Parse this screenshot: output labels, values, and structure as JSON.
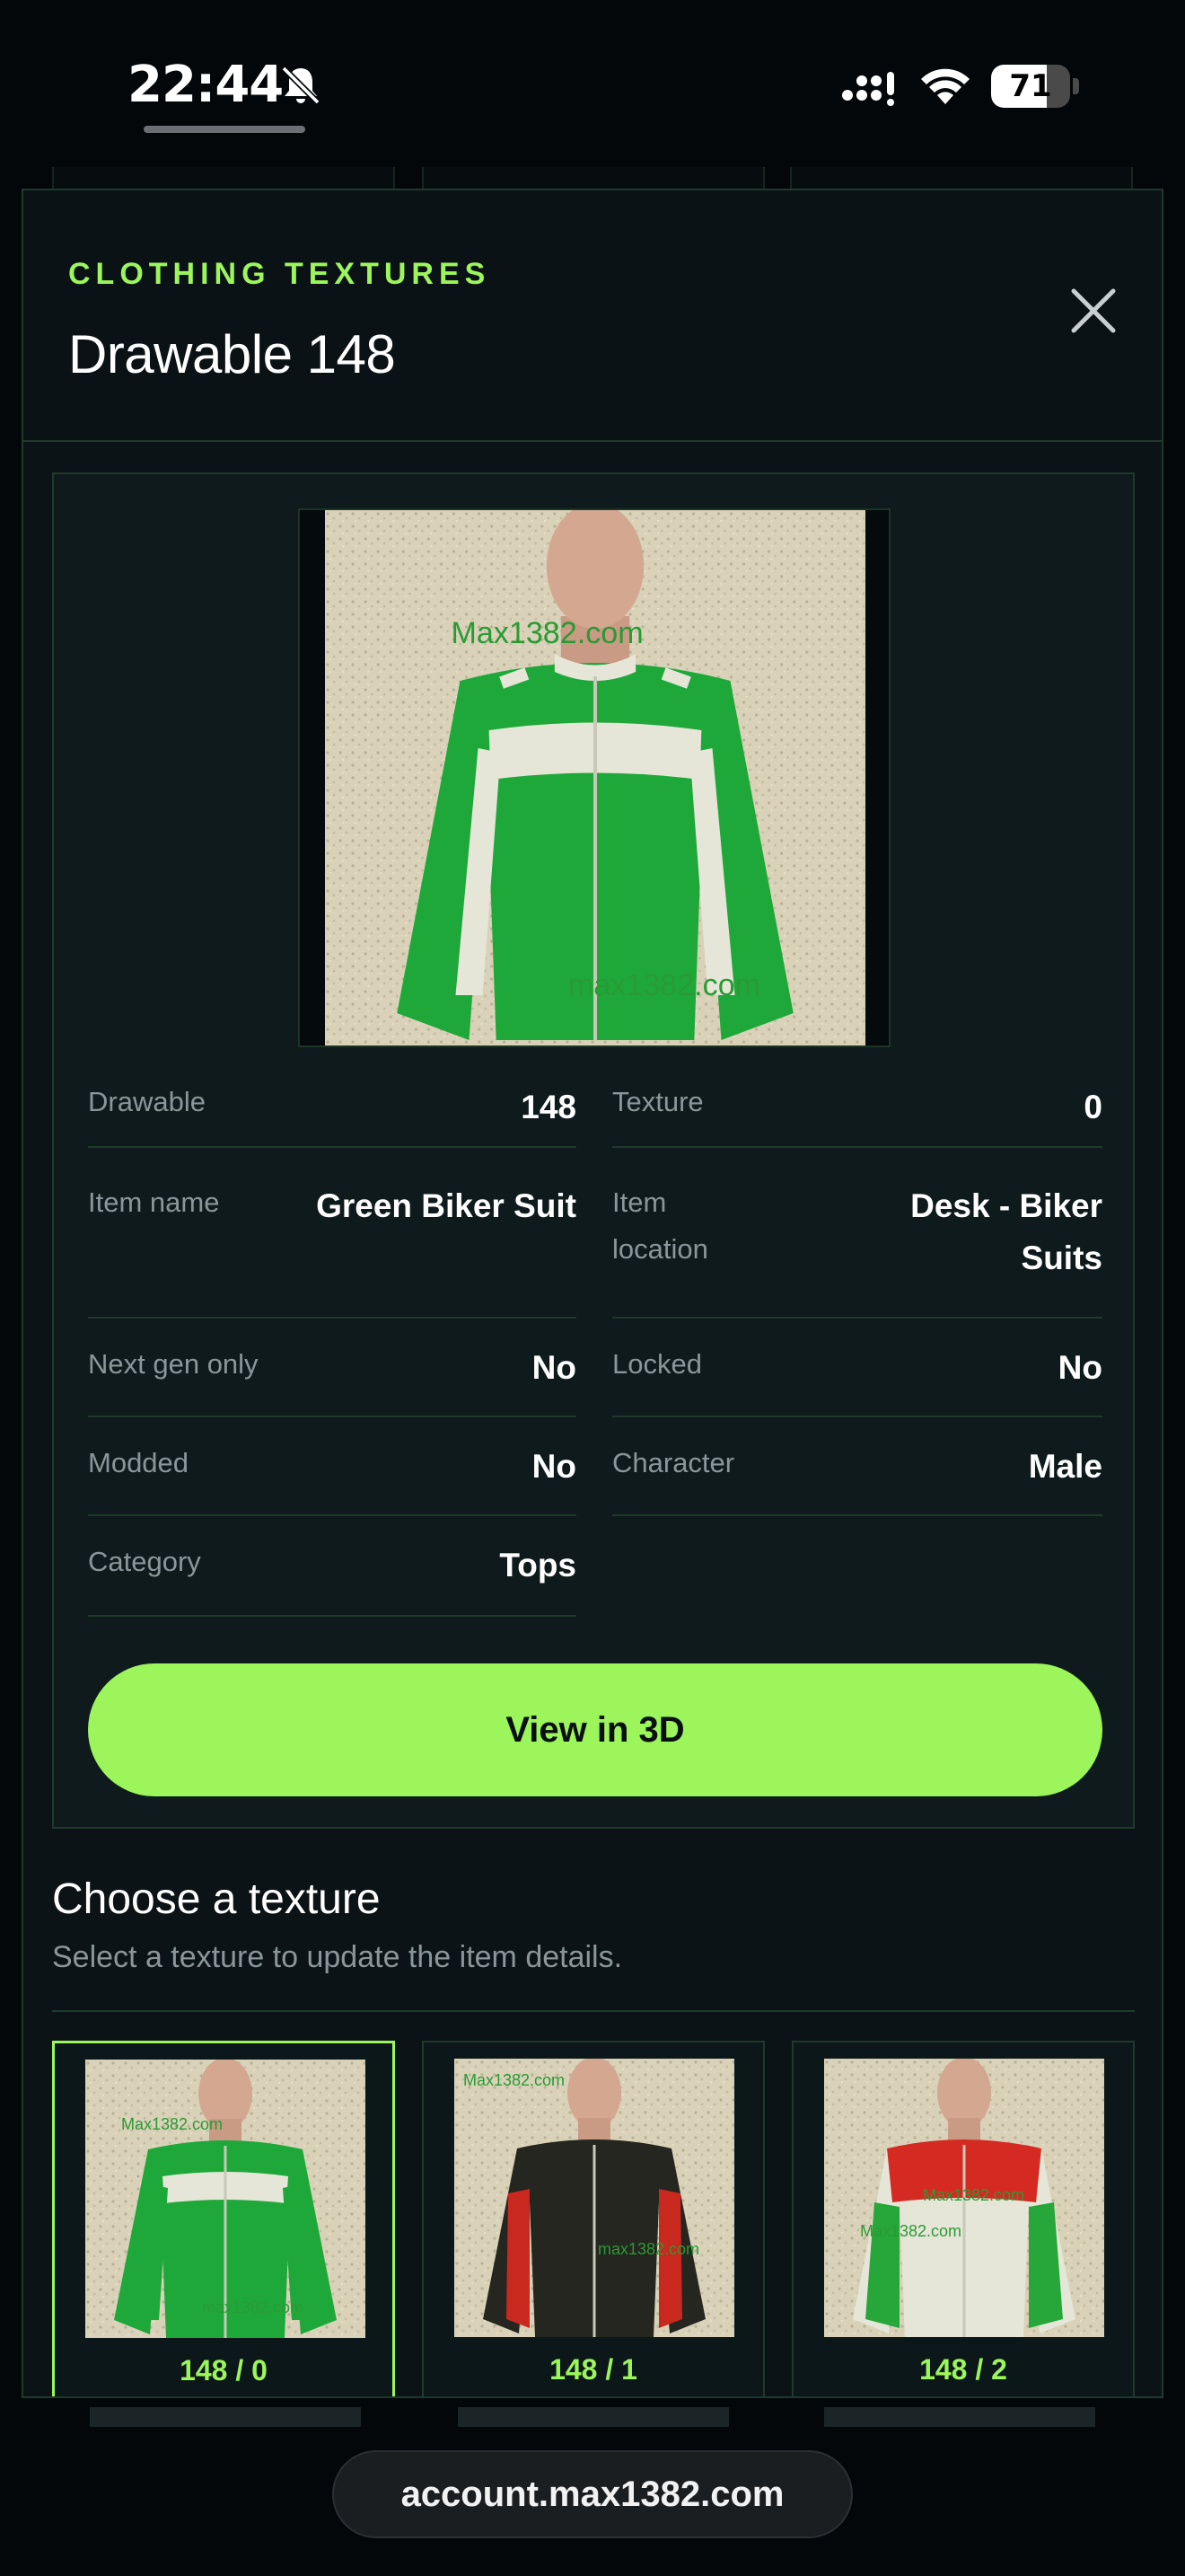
{
  "status_bar": {
    "time": "22:44",
    "battery": "71",
    "battery_level": 0.71
  },
  "modal": {
    "eyebrow": "CLOTHING TEXTURES",
    "title": "Drawable 148",
    "close_icon": "close-icon"
  },
  "preview": {
    "watermark_top": "Max1382.com",
    "watermark_bottom": "max1382.com"
  },
  "details": {
    "drawable_label": "Drawable",
    "drawable_value": "148",
    "texture_label": "Texture",
    "texture_value": "0",
    "item_name_label": "Item name",
    "item_name_value": "Green Biker Suit",
    "item_location_label_1": "Item",
    "item_location_label_2": "location",
    "item_location_value_1": "Desk - Biker",
    "item_location_value_2": "Suits",
    "next_gen_label": "Next gen only",
    "next_gen_value": "No",
    "locked_label": "Locked",
    "locked_value": "No",
    "modded_label": "Modded",
    "modded_value": "No",
    "character_label": "Character",
    "character_value": "Male",
    "category_label": "Category",
    "category_value": "Tops"
  },
  "view3d_label": "View in 3D",
  "textures": {
    "title": "Choose a texture",
    "subtitle": "Select a texture to update the item details.",
    "items": [
      {
        "label": "148 / 0",
        "selected": true,
        "colors": {
          "main": "#1fa83a",
          "band": "#e6e6d8",
          "sleeve": "#1fa83a"
        },
        "wm1": "Max1382.com",
        "wm2": "max1382.com"
      },
      {
        "label": "148 / 1",
        "selected": false,
        "colors": {
          "main": "#24261f",
          "band": "#24261f",
          "sleeve": "#c8281e"
        },
        "wm1": "Max1382.com",
        "wm2": "max1382.com"
      },
      {
        "label": "148 / 2",
        "selected": false,
        "colors": {
          "main": "#e6e6d8",
          "band": "#d42a22",
          "sleeve": "#27a63a"
        },
        "wm1": "Max1382.com",
        "wm2": "Max1382.com"
      }
    ]
  },
  "url_bar": {
    "url": "account.max1382.com"
  },
  "colors": {
    "accent": "#9cf55a",
    "background": "#03070a",
    "panel": "#0e1a1c",
    "border": "#1f3a2a"
  }
}
